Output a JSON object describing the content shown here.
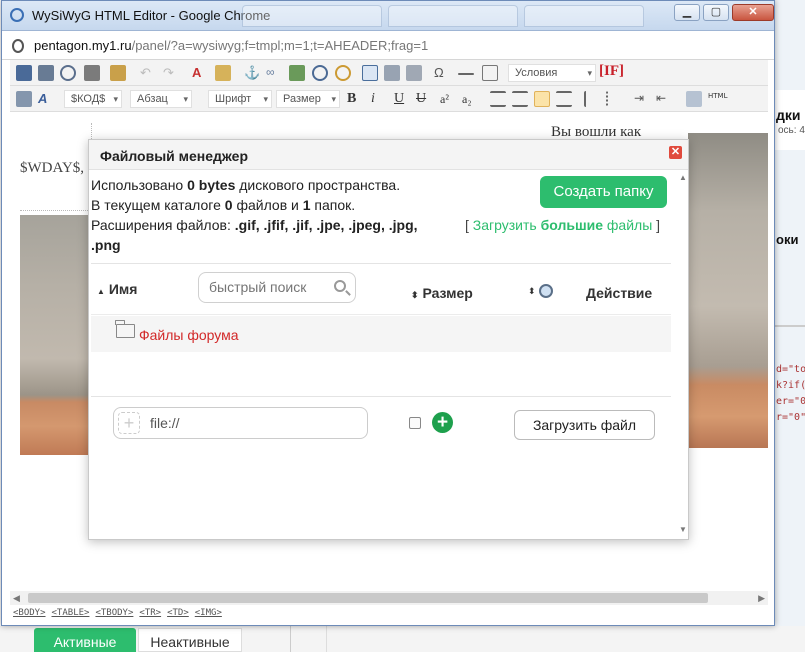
{
  "browser": {
    "window_title": "WySiWyG HTML Editor - Google Chrome",
    "url_host": "pentagon.my1.ru",
    "url_path": "/panel/?a=wysiwyg;f=tmpl;m=1;t=AHEADER;frag=1"
  },
  "toolbar": {
    "conditions": "Условия",
    "if_label": "[IF]",
    "code_select": "$КОД$",
    "paragraph_select": "Абзац",
    "font_select": "Шрифт",
    "size_select": "Размер",
    "html_label": "HTML"
  },
  "editor": {
    "wday": "$WDAY$,",
    "logged_in": "Вы вошли как"
  },
  "pathbar": [
    "<BODY>",
    "<TABLE>",
    "<TBODY>",
    "<TR>",
    "<TD>",
    "<IMG>"
  ],
  "file_manager": {
    "title": "Файловый менеджер",
    "used_prefix": "Использовано ",
    "used_value": "0 bytes",
    "used_suffix": " дискового пространства.",
    "dir_prefix": "В текущем каталоге ",
    "dir_files": "0",
    "dir_mid": " файлов и ",
    "dir_folders": "1",
    "dir_suffix": " папок.",
    "ext_prefix": "Расширения файлов: ",
    "ext_list1": ".gif, .jfif, .jif, .jpe, .jpeg, .jpg,",
    "ext_list2": ".png",
    "create_folder": "Создать папку",
    "upload_big_pre": "Загрузить ",
    "upload_big_bold": "большие",
    "upload_big_post": " файлы",
    "col_name": "Имя",
    "search_placeholder": "быстрый поиск",
    "col_size": "Размер",
    "col_action": "Действие",
    "folder_name": "Файлы форума",
    "file_value": "file://",
    "upload_file": "Загрузить файл"
  },
  "background": {
    "right_title": "дки",
    "right_sub": "ось: 4",
    "right_bold": "оки",
    "right_code": "d=\"to\nk?if(\ner=\"0\nr=\"0\"",
    "tab_active": "Активные",
    "tab_inactive": "Неактивные"
  },
  "colors": {
    "accent_green": "#2dbd6e",
    "folder_link_red": "#d22828",
    "close_red": "#e04a3d"
  }
}
